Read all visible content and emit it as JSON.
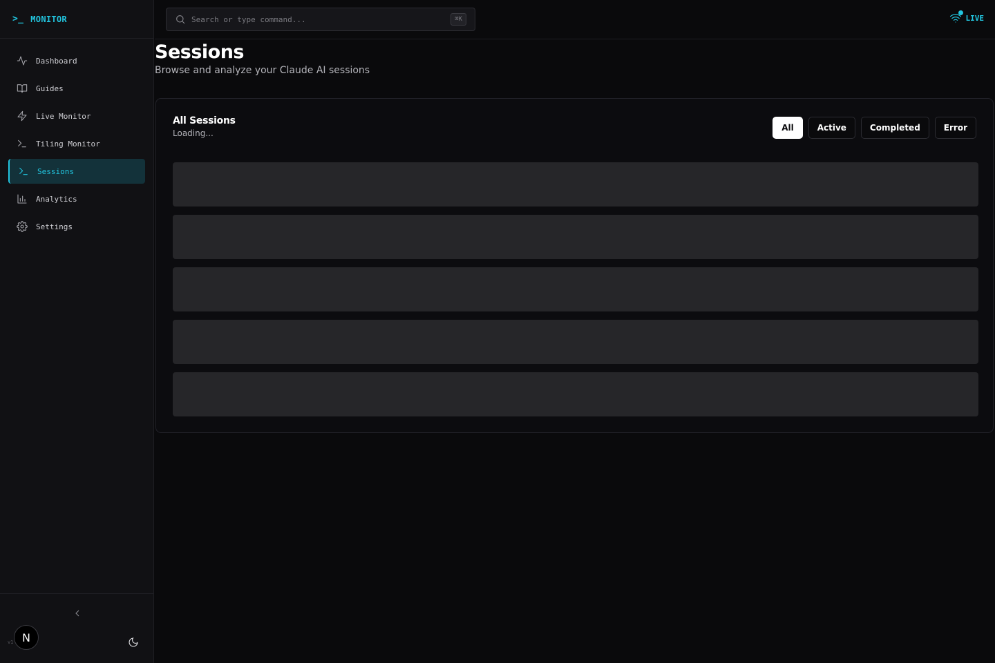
{
  "brand": {
    "prompt": ">_",
    "name": "MONITOR"
  },
  "sidebar": {
    "items": [
      {
        "label": "Dashboard",
        "icon": "activity-icon",
        "active": false
      },
      {
        "label": "Guides",
        "icon": "book-open-icon",
        "active": false
      },
      {
        "label": "Live Monitor",
        "icon": "zap-icon",
        "active": false
      },
      {
        "label": "Tiling Monitor",
        "icon": "terminal-icon",
        "active": false
      },
      {
        "label": "Sessions",
        "icon": "terminal-icon",
        "active": true
      },
      {
        "label": "Analytics",
        "icon": "bar-chart-icon",
        "active": false
      },
      {
        "label": "Settings",
        "icon": "gear-icon",
        "active": false
      }
    ],
    "avatar_initial": "N",
    "version": "v1"
  },
  "search": {
    "placeholder": "Search or type command...",
    "shortcut": "⌘K"
  },
  "status": {
    "live_label": "LIVE",
    "accent": "#22c6e0"
  },
  "page": {
    "title": "Sessions",
    "subtitle": "Browse and analyze your Claude AI sessions"
  },
  "card": {
    "title": "All Sessions",
    "status": "Loading...",
    "filters": [
      {
        "label": "All",
        "active": true
      },
      {
        "label": "Active",
        "active": false
      },
      {
        "label": "Completed",
        "active": false
      },
      {
        "label": "Error",
        "active": false
      }
    ],
    "skeleton_rows": 5
  }
}
